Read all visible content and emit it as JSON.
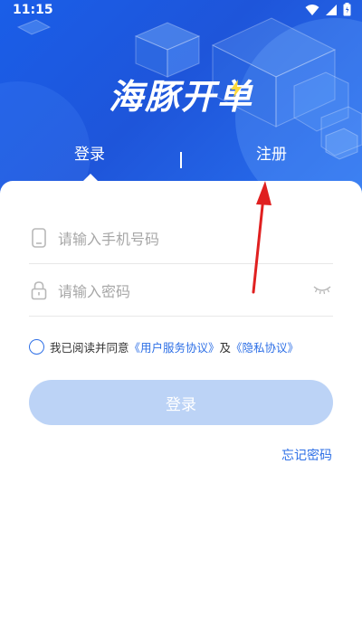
{
  "status_bar": {
    "time": "11:15"
  },
  "app": {
    "logo_text": "海豚开单"
  },
  "tabs": {
    "login": "登录",
    "register": "注册"
  },
  "form": {
    "phone_placeholder": "请输入手机号码",
    "password_placeholder": "请输入密码",
    "agreement": {
      "prefix": "我已阅读并同意",
      "user_agreement": "《用户服务协议》",
      "and": "及",
      "privacy": "《隐私协议》"
    },
    "login_button": "登录",
    "forgot_password": "忘记密码"
  },
  "colors": {
    "hero_blue": "#1e55da",
    "accent": "#2d6fe6",
    "button_disabled": "#bcd3f6",
    "annotation_arrow": "#e02020"
  },
  "icons": [
    "phone-icon",
    "lock-icon",
    "eye-closed-icon",
    "wifi-icon",
    "signal-icon",
    "battery-icon"
  ]
}
